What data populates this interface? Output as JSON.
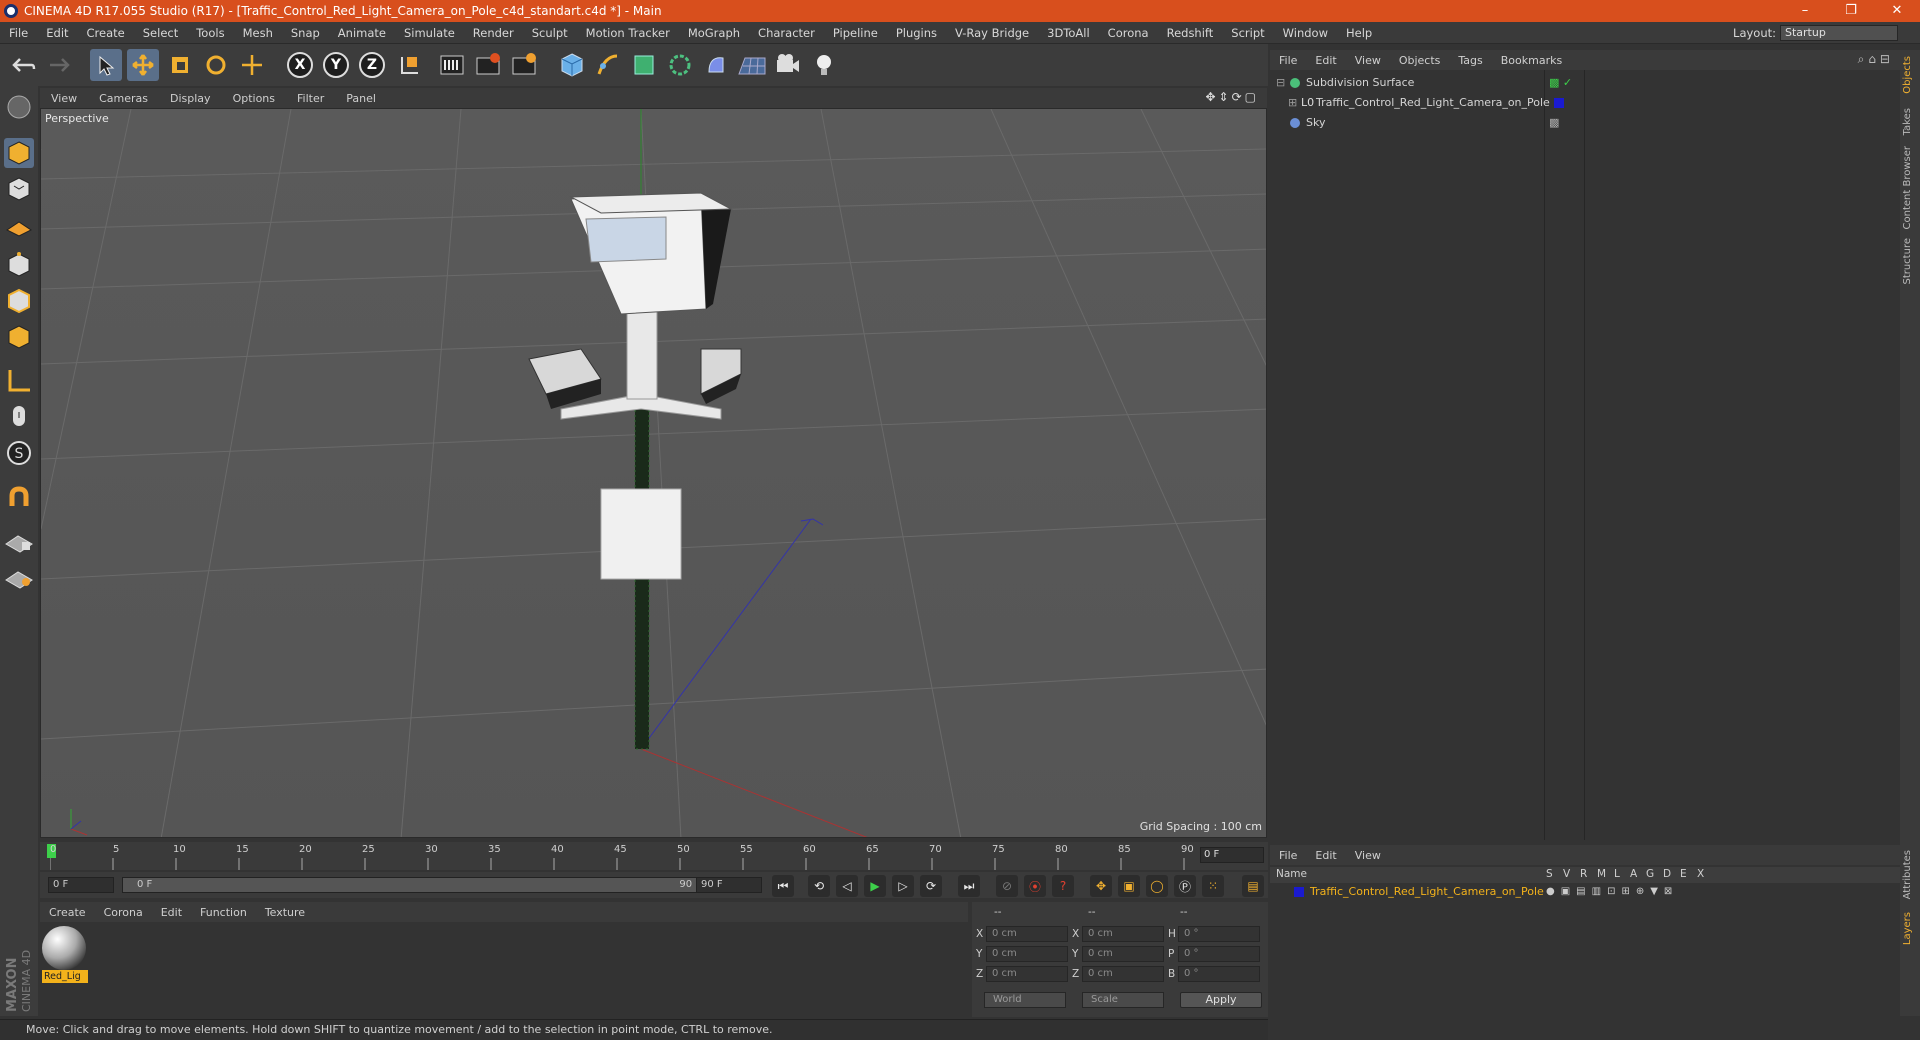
{
  "window": {
    "title": "CINEMA 4D R17.055 Studio (R17) - [Traffic_Control_Red_Light_Camera_on_Pole_c4d_standart.c4d *] - Main",
    "minimize": "–",
    "restore": "❐",
    "close": "✕"
  },
  "menu": [
    "File",
    "Edit",
    "Create",
    "Select",
    "Tools",
    "Mesh",
    "Snap",
    "Animate",
    "Simulate",
    "Render",
    "Sculpt",
    "Motion Tracker",
    "MoGraph",
    "Character",
    "Pipeline",
    "Plugins",
    "V-Ray Bridge",
    "3DToAll",
    "Corona",
    "Redshift",
    "Script",
    "Window",
    "Help"
  ],
  "layout": {
    "label": "Layout:",
    "value": "Startup"
  },
  "toolbar": {
    "axes": [
      "X",
      "Y",
      "Z"
    ],
    "icons": [
      "undo-icon",
      "redo-icon",
      "select-arrow-icon",
      "move-icon",
      "scale-icon",
      "rotate-icon",
      "live-transform-icon",
      "x-axis-icon",
      "y-axis-icon",
      "z-axis-icon",
      "coordinate-system-icon",
      "render-view-icon",
      "render-picture-viewer-icon",
      "edit-render-settings-icon",
      "cube-icon",
      "pen-icon",
      "subdivision-icon",
      "array-icon",
      "deformer-icon",
      "floor-icon",
      "camera-icon",
      "light-icon"
    ]
  },
  "viewport": {
    "menu": [
      "View",
      "Cameras",
      "Display",
      "Options",
      "Filter",
      "Panel"
    ],
    "label": "Perspective",
    "grid_spacing": "Grid Spacing : 100 cm"
  },
  "timeline": {
    "ticks": [
      "0",
      "5",
      "10",
      "15",
      "20",
      "25",
      "30",
      "35",
      "40",
      "45",
      "50",
      "55",
      "60",
      "65",
      "70",
      "75",
      "80",
      "85",
      "90"
    ],
    "current_frame": "0 F",
    "start": "0 F",
    "range_start": "0 F",
    "range_end": "90 F",
    "end": "90 F"
  },
  "materials": {
    "menu": [
      "Create",
      "Corona",
      "Edit",
      "Function",
      "Texture"
    ],
    "items": [
      {
        "name": "Red_Lig"
      }
    ]
  },
  "coordinates": {
    "headers": [
      "--",
      "--",
      "--"
    ],
    "rows": [
      {
        "a": "X",
        "av": "0 cm",
        "b": "X",
        "bv": "0 cm",
        "c": "H",
        "cv": "0 °"
      },
      {
        "a": "Y",
        "av": "0 cm",
        "b": "Y",
        "bv": "0 cm",
        "c": "P",
        "cv": "0 °"
      },
      {
        "a": "Z",
        "av": "0 cm",
        "b": "Z",
        "bv": "0 cm",
        "c": "B",
        "cv": "0 °"
      }
    ],
    "world": "World",
    "scale": "Scale",
    "apply": "Apply"
  },
  "status": "Move: Click and drag to move elements. Hold down SHIFT to quantize movement / add to the selection in point mode, CTRL to remove.",
  "object_manager": {
    "menu": [
      "File",
      "Edit",
      "View",
      "Objects",
      "Tags",
      "Bookmarks"
    ],
    "objects": [
      {
        "name": "Subdivision Surface",
        "color": "#4bc07a"
      },
      {
        "name": "Traffic_Control_Red_Light_Camera_on_Pole",
        "color": "#1a1ad0"
      },
      {
        "name": "Sky",
        "color": "#6b8fd6"
      }
    ]
  },
  "right_tabs": [
    "Objects",
    "Takes",
    "Content Browser",
    "Structure",
    "Attributes",
    "Layers"
  ],
  "layer_manager": {
    "menu": [
      "File",
      "Edit",
      "View"
    ],
    "columns": [
      "Name",
      "S",
      "V",
      "R",
      "M",
      "L",
      "A",
      "G",
      "D",
      "E",
      "X"
    ],
    "layer_name": "Traffic_Control_Red_Light_Camera_on_Pole",
    "layer_color": "#1a1ad0"
  },
  "maxon": {
    "line1": "MAXON",
    "line2": "CINEMA 4D"
  },
  "colors": {
    "accent": "#d84f1d",
    "selection": "#5a6f8a",
    "material_label": "#f3b21b",
    "layer_text": "#f3b21b"
  }
}
